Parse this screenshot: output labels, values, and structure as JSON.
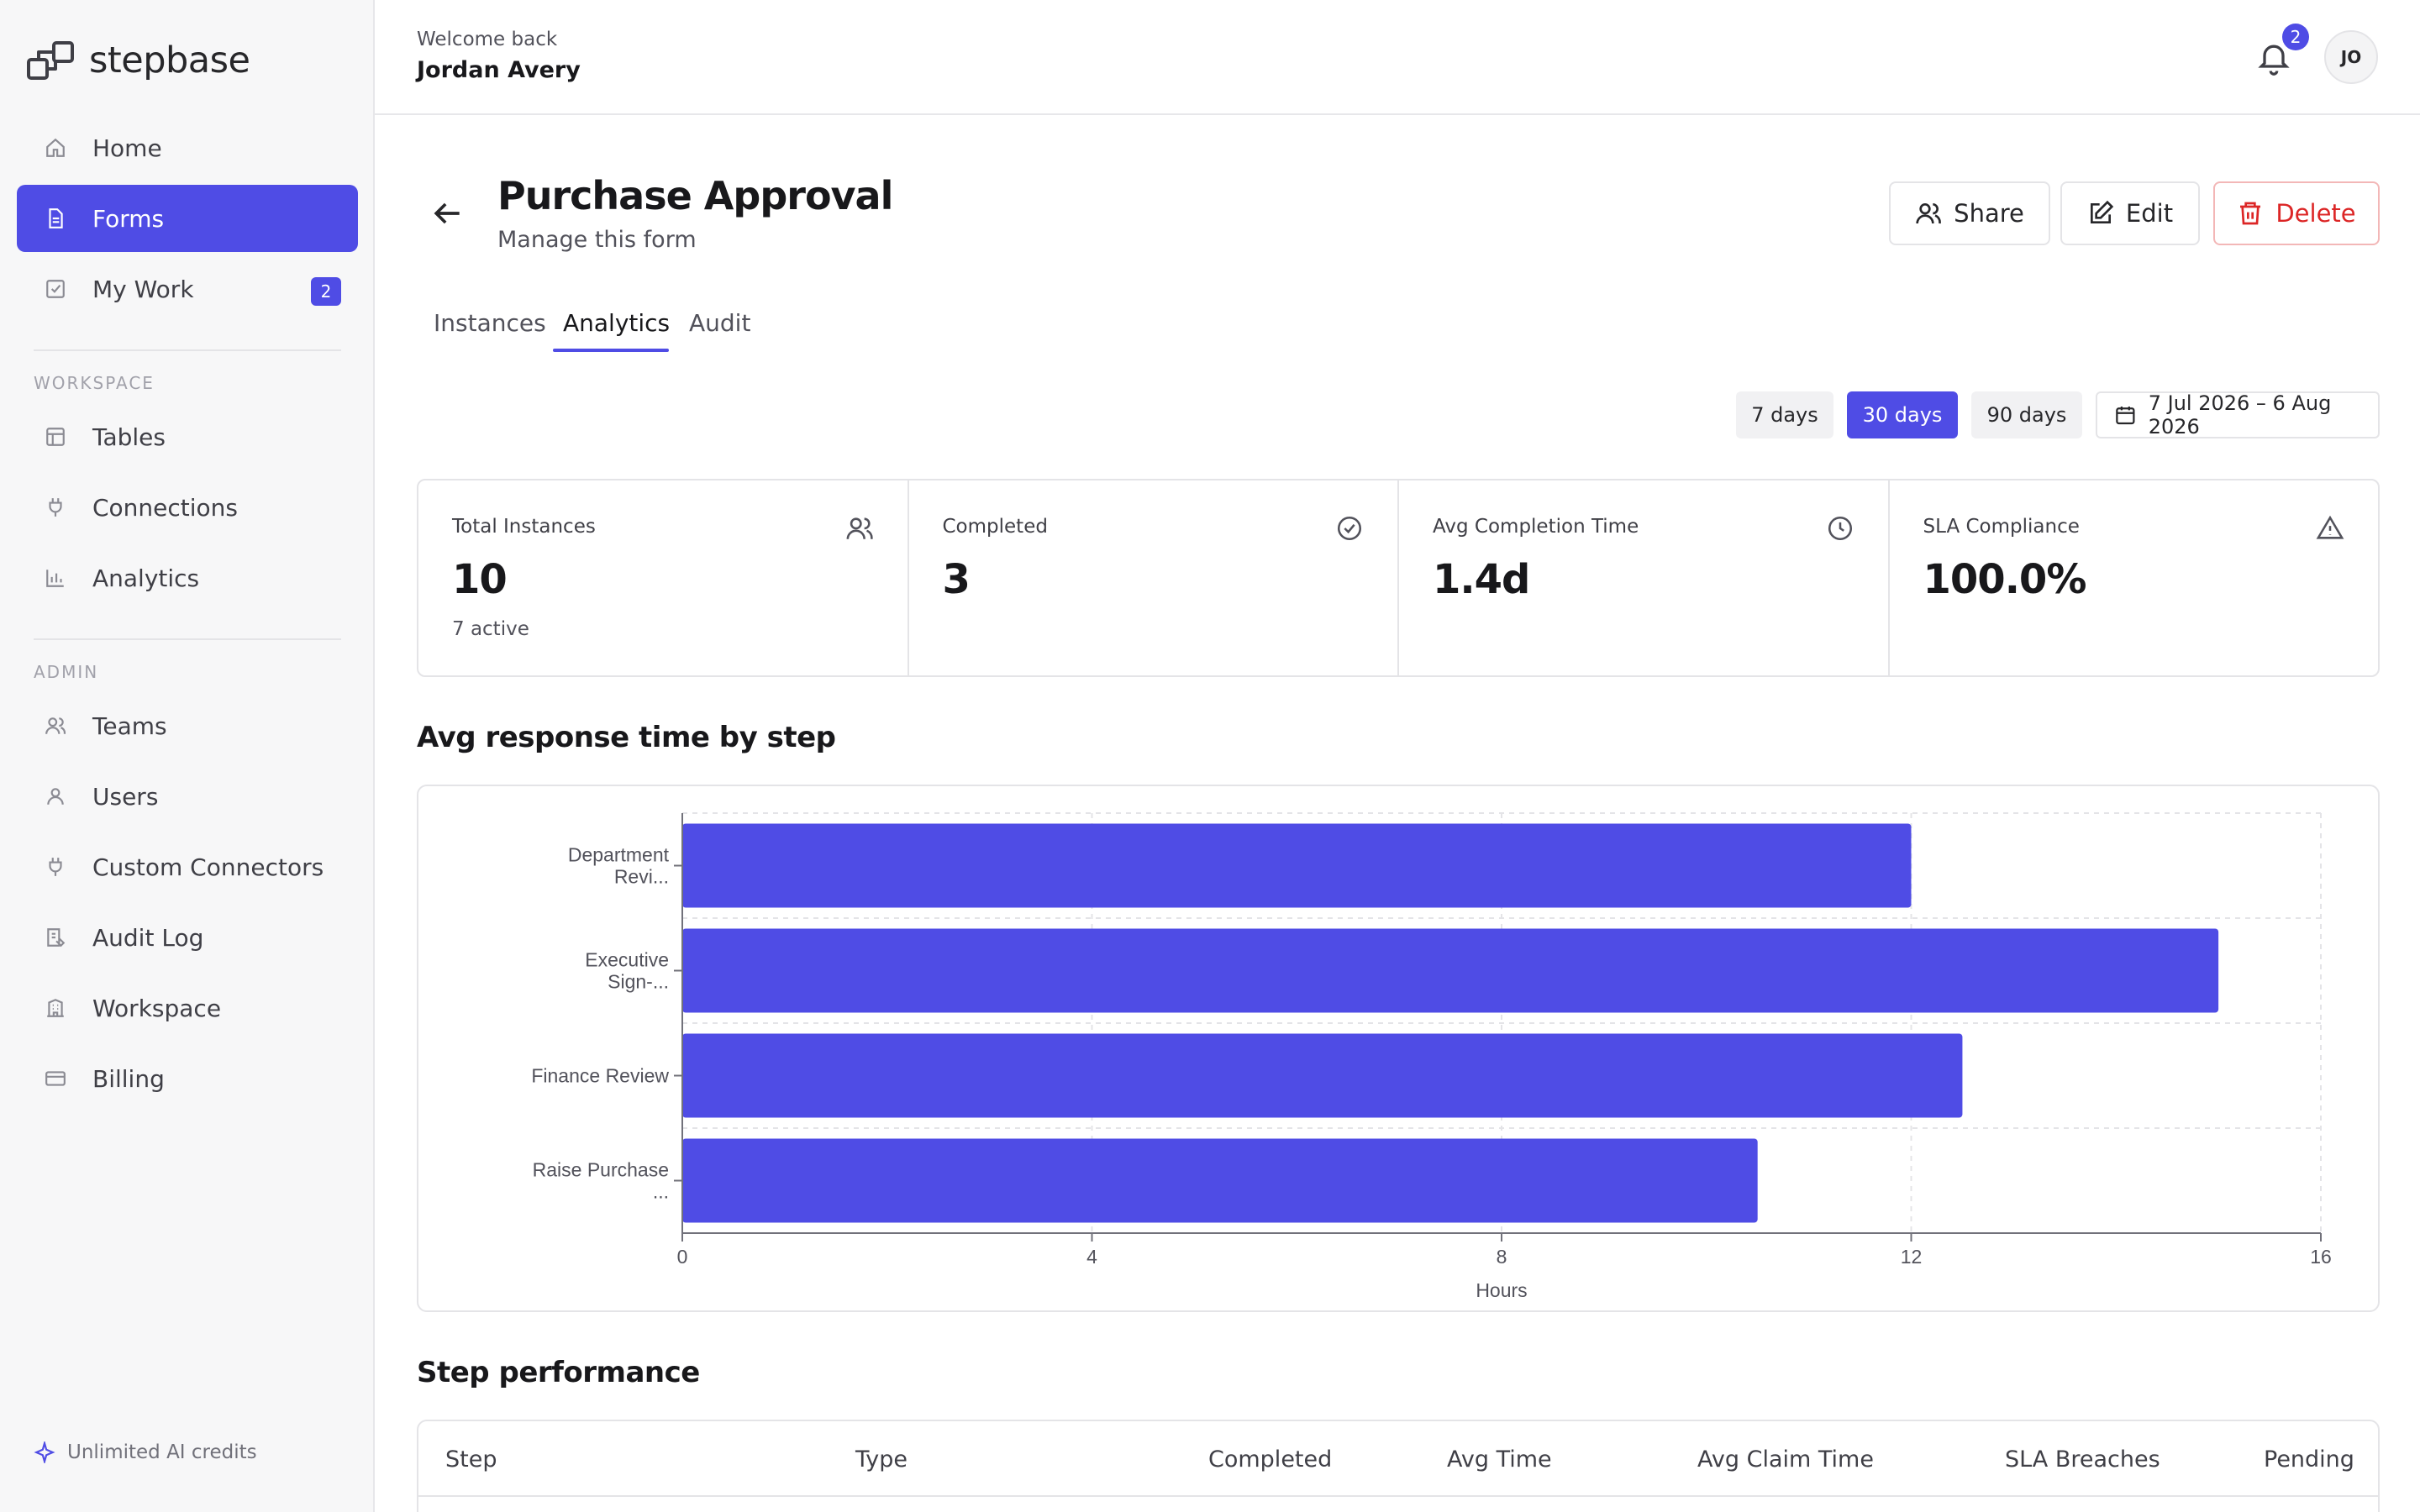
{
  "app": {
    "name": "stepbase"
  },
  "sidebar": {
    "items": [
      {
        "label": "Home",
        "icon": "home-icon"
      },
      {
        "label": "Forms",
        "icon": "document-icon",
        "active": true
      },
      {
        "label": "My Work",
        "icon": "checkbox-icon",
        "badge": "2"
      }
    ],
    "workspace_title": "WORKSPACE",
    "workspace_items": [
      {
        "label": "Tables",
        "icon": "table-icon"
      },
      {
        "label": "Connections",
        "icon": "plug-icon"
      },
      {
        "label": "Analytics",
        "icon": "bar-chart-icon"
      }
    ],
    "admin_title": "ADMIN",
    "admin_items": [
      {
        "label": "Teams",
        "icon": "users-icon"
      },
      {
        "label": "Users",
        "icon": "user-icon"
      },
      {
        "label": "Custom Connectors",
        "icon": "plug-icon"
      },
      {
        "label": "Audit Log",
        "icon": "log-icon"
      },
      {
        "label": "Workspace",
        "icon": "building-icon"
      },
      {
        "label": "Billing",
        "icon": "credit-card-icon"
      }
    ],
    "footer": "Unlimited AI credits"
  },
  "topbar": {
    "welcome": "Welcome back",
    "user_name": "Jordan Avery",
    "notification_count": "2",
    "avatar_initials": "JO"
  },
  "header": {
    "title": "Purchase Approval",
    "subtitle": "Manage this form",
    "share_label": "Share",
    "edit_label": "Edit",
    "delete_label": "Delete"
  },
  "tabs": [
    {
      "label": "Instances"
    },
    {
      "label": "Analytics",
      "active": true
    },
    {
      "label": "Audit"
    }
  ],
  "range": {
    "options": [
      "7 days",
      "30 days",
      "90 days"
    ],
    "selected": "30 days",
    "date_range": "7 Jul 2026 – 6 Aug 2026"
  },
  "stats": [
    {
      "label": "Total Instances",
      "value": "10",
      "sub": "7 active",
      "icon": "users-icon"
    },
    {
      "label": "Completed",
      "value": "3",
      "sub": "",
      "icon": "check-circle-icon"
    },
    {
      "label": "Avg Completion Time",
      "value": "1.4d",
      "sub": "",
      "icon": "clock-icon"
    },
    {
      "label": "SLA Compliance",
      "value": "100.0%",
      "sub": "",
      "icon": "alert-triangle-icon"
    }
  ],
  "chart_title": "Avg response time by step",
  "chart_data": {
    "type": "bar",
    "orientation": "horizontal",
    "categories": [
      [
        "Department",
        "Revi..."
      ],
      [
        "Executive",
        "Sign-..."
      ],
      [
        "Finance Review"
      ],
      [
        "Raise Purchase",
        "..."
      ]
    ],
    "values": [
      12,
      15,
      12.5,
      10.5
    ],
    "xlabel": "Hours",
    "xlim": [
      0,
      16
    ],
    "xticks": [
      0,
      4,
      8,
      12,
      16
    ],
    "grid": true,
    "color": "#4f4ce5"
  },
  "table_title": "Step performance",
  "table": {
    "columns": [
      "Step",
      "Type",
      "Completed",
      "Avg Time",
      "Avg Claim Time",
      "SLA Breaches",
      "Pending"
    ]
  },
  "colors": {
    "accent": "#4f4ce5",
    "danger": "#dc2626"
  }
}
